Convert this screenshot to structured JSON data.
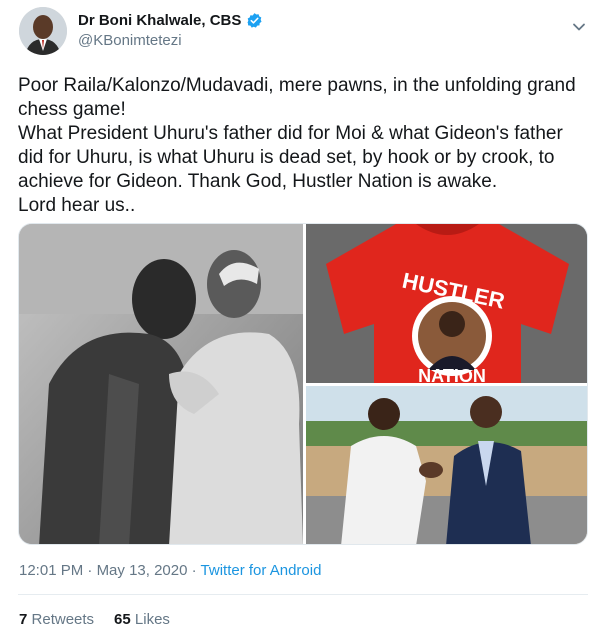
{
  "author": {
    "display_name": "Dr Boni Khalwale, CBS",
    "handle": "@KBonimtetezi",
    "verified": true
  },
  "tweet": {
    "text": "Poor Raila/Kalonzo/Mudavadi, mere pawns, in the unfolding grand chess game!\nWhat President Uhuru's father did for Moi & what Gideon's father did for  Uhuru, is what Uhuru is dead set, by hook or by crook, to achieve for Gideon. Thank God, Hustler Nation is awake.\nLord hear us..",
    "time": "12:01 PM",
    "separator": "·",
    "date": "May 13, 2020",
    "source": "Twitter for Android"
  },
  "media": {
    "shirt_text": "HUSTLER",
    "shirt_bottom_text": "NATION"
  },
  "stats": {
    "retweets_count": "7",
    "retweets_label": "Retweets",
    "likes_count": "65",
    "likes_label": "Likes"
  },
  "colors": {
    "text": "#14171a",
    "secondary": "#657786",
    "link": "#1b95e0",
    "verified": "#1da1f2",
    "shirt_red": "#e0261d"
  },
  "icons": {
    "verified": "verified-badge-icon",
    "more": "chevron-down-icon"
  }
}
